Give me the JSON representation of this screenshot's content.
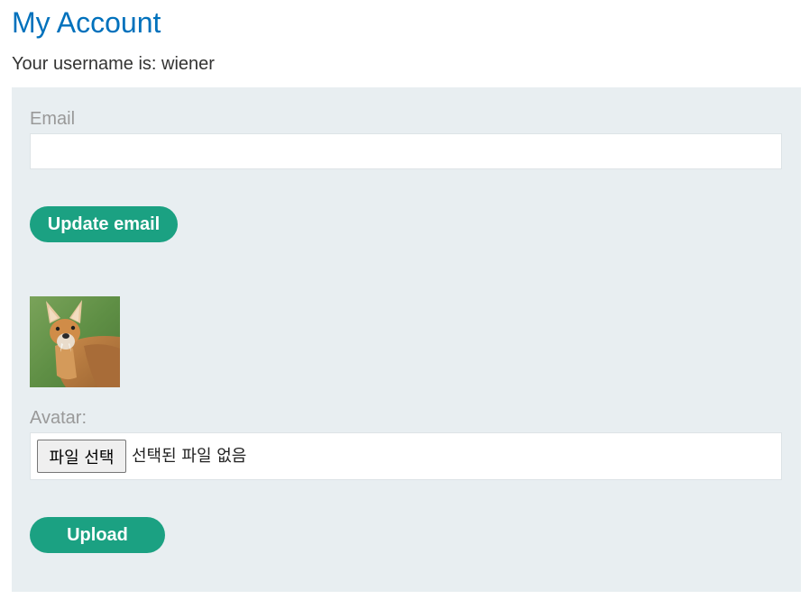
{
  "page": {
    "title": "My Account",
    "username_line": "Your username is: wiener"
  },
  "email_form": {
    "label": "Email",
    "value": "",
    "placeholder": "",
    "submit_label": "Update email"
  },
  "avatar_form": {
    "label": "Avatar:",
    "file_button_label": "파일 선택",
    "file_status": "선택된 파일 없음",
    "submit_label": "Upload"
  },
  "colors": {
    "title": "#0071bc",
    "button": "#1ba182",
    "panel": "#e8eef1"
  }
}
